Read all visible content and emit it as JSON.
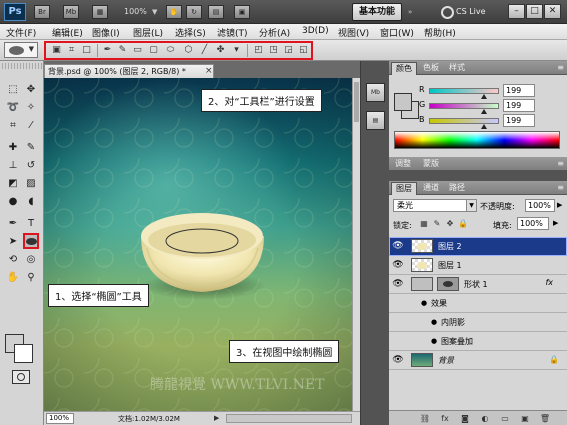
{
  "appbar": {
    "logo": "Ps",
    "icon_br": "Br",
    "icon_mb": "Mb",
    "zoom": "100%",
    "essentials": "基本功能",
    "cslive": "CS Live",
    "minimize": "–",
    "restore": "□",
    "close": "✕"
  },
  "menu": {
    "items": [
      "文件(F)",
      "编辑(E)",
      "图像(I)",
      "图层(L)",
      "选择(S)",
      "滤镜(T)",
      "分析(A)",
      "3D(D)",
      "视图(V)",
      "窗口(W)",
      "帮助(H)"
    ]
  },
  "document": {
    "tab_title": "背景.psd @ 100% (图层 2, RGB/8) *",
    "zoom": "100%",
    "doc_size": "文档:1.02M/3.02M"
  },
  "callouts": {
    "select_ellipse": "1、选择“椭圆”工具",
    "options_bar": "2、对“工具栏”进行设置",
    "draw_ellipse": "3、在视图中绘制椭圆"
  },
  "watermark": "腾龍視覺 WWW.TLVI.NET",
  "color_panel": {
    "tabs": [
      "颜色",
      "色板",
      "样式"
    ],
    "channels": [
      {
        "label": "R",
        "value": "199",
        "level": 0.78,
        "gradient": "linear-gradient(to right,#00c7c7,#ffc7c7)"
      },
      {
        "label": "G",
        "value": "199",
        "level": 0.78,
        "gradient": "linear-gradient(to right,#c700c7,#c7ffc7)"
      },
      {
        "label": "B",
        "value": "199",
        "level": 0.78,
        "gradient": "linear-gradient(to right,#c7c700,#c7c7ff)"
      }
    ]
  },
  "adjust_panel": {
    "tabs": [
      "调整",
      "蒙版"
    ]
  },
  "layers_panel": {
    "tabs": [
      "图层",
      "通道",
      "路径"
    ],
    "blend_mode": "柔光",
    "opacity_label": "不透明度:",
    "opacity": "100%",
    "lock_label": "锁定:",
    "fill_label": "填充:",
    "fill": "100%",
    "layers": [
      {
        "name": "图层 2",
        "selected": true,
        "thumb": "bowl"
      },
      {
        "name": "图层 1",
        "selected": false,
        "thumb": "bowl"
      },
      {
        "name": "形状 1",
        "selected": false,
        "thumb": "shape",
        "fx": "fx"
      },
      {
        "name": "效果",
        "selected": false,
        "thumb": "none",
        "sub": 1
      },
      {
        "name": "内阴影",
        "selected": false,
        "thumb": "none",
        "sub": 2
      },
      {
        "name": "图案叠加",
        "selected": false,
        "thumb": "none",
        "sub": 2
      },
      {
        "name": "背景",
        "selected": false,
        "thumb": "bg",
        "locked": true
      }
    ]
  },
  "colors": {
    "highlight_red": "#e0141e",
    "layer_selected": "#1c3a8a"
  }
}
